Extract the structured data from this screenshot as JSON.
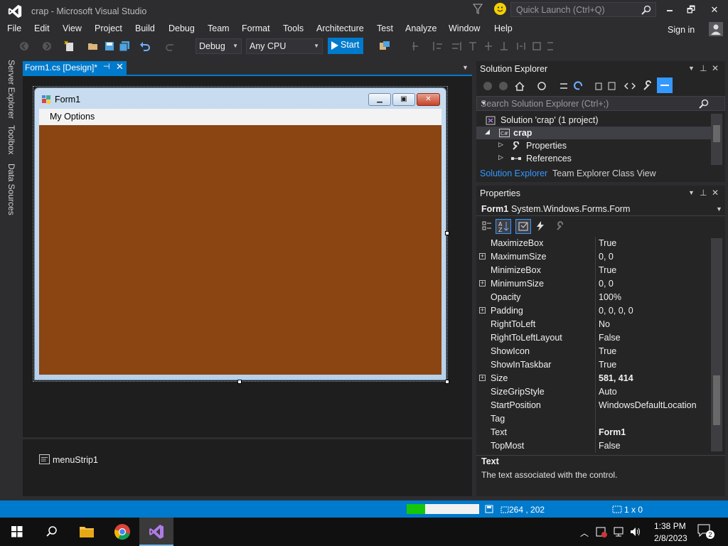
{
  "window": {
    "title": "crap - Microsoft Visual Studio",
    "quick_launch_placeholder": "Quick Launch (Ctrl+Q)",
    "minimize": "🗕",
    "maximize": "🗗",
    "close": "✕",
    "accent_color": "#007acc"
  },
  "menu": {
    "items": [
      "File",
      "Edit",
      "View",
      "Project",
      "Build",
      "Debug",
      "Team",
      "Format",
      "Tools",
      "Architecture",
      "Test",
      "Analyze",
      "Window",
      "Help"
    ],
    "sign_in": "Sign in"
  },
  "toolbar": {
    "config": "Debug",
    "platform": "Any CPU",
    "start": "Start"
  },
  "left_tabs": [
    "Server Explorer",
    "Toolbox",
    "Data Sources"
  ],
  "document": {
    "tab_label": "Form1.cs [Design]*",
    "pin": "⊣",
    "close": "✕"
  },
  "form": {
    "title": "Form1",
    "menu_item": "My Options",
    "back_color": "#8b4513"
  },
  "tray": {
    "component": "menuStrip1"
  },
  "solution_explorer": {
    "title": "Solution Explorer",
    "search_placeholder": "Search Solution Explorer (Ctrl+;)",
    "tree": [
      {
        "label": "Solution 'crap' (1 project)",
        "icon": "solution-icon"
      },
      {
        "label": "crap",
        "icon": "csharp-project-icon"
      },
      {
        "label": "Properties",
        "icon": "wrench-icon"
      },
      {
        "label": "References",
        "icon": "references-icon"
      }
    ],
    "tabs": [
      "Solution Explorer",
      "Team Explorer",
      "Class View"
    ]
  },
  "properties": {
    "title": "Properties",
    "object_name": "Form1",
    "object_type": "System.Windows.Forms.Form",
    "rows": [
      {
        "name": "MaximizeBox",
        "value": "True",
        "expand": false,
        "bold": false
      },
      {
        "name": "MaximumSize",
        "value": "0, 0",
        "expand": true,
        "bold": false
      },
      {
        "name": "MinimizeBox",
        "value": "True",
        "expand": false,
        "bold": false
      },
      {
        "name": "MinimumSize",
        "value": "0, 0",
        "expand": true,
        "bold": false
      },
      {
        "name": "Opacity",
        "value": "100%",
        "expand": false,
        "bold": false
      },
      {
        "name": "Padding",
        "value": "0, 0, 0, 0",
        "expand": true,
        "bold": false
      },
      {
        "name": "RightToLeft",
        "value": "No",
        "expand": false,
        "bold": false
      },
      {
        "name": "RightToLeftLayout",
        "value": "False",
        "expand": false,
        "bold": false
      },
      {
        "name": "ShowIcon",
        "value": "True",
        "expand": false,
        "bold": false
      },
      {
        "name": "ShowInTaskbar",
        "value": "True",
        "expand": false,
        "bold": false
      },
      {
        "name": "Size",
        "value": "581, 414",
        "expand": true,
        "bold": true
      },
      {
        "name": "SizeGripStyle",
        "value": "Auto",
        "expand": false,
        "bold": false
      },
      {
        "name": "StartPosition",
        "value": "WindowsDefaultLocation",
        "expand": false,
        "bold": false
      },
      {
        "name": "Tag",
        "value": "",
        "expand": false,
        "bold": false
      },
      {
        "name": "Text",
        "value": "Form1",
        "expand": false,
        "bold": true
      },
      {
        "name": "TopMost",
        "value": "False",
        "expand": false,
        "bold": false
      }
    ],
    "desc_title": "Text",
    "desc_text": "The text associated with the control."
  },
  "statusbar": {
    "position": "264 , 202",
    "size": "1 x 0",
    "progress": 0.25
  },
  "taskbar": {
    "time": "1:38 PM",
    "date": "2/8/2023",
    "notifications": "2"
  }
}
